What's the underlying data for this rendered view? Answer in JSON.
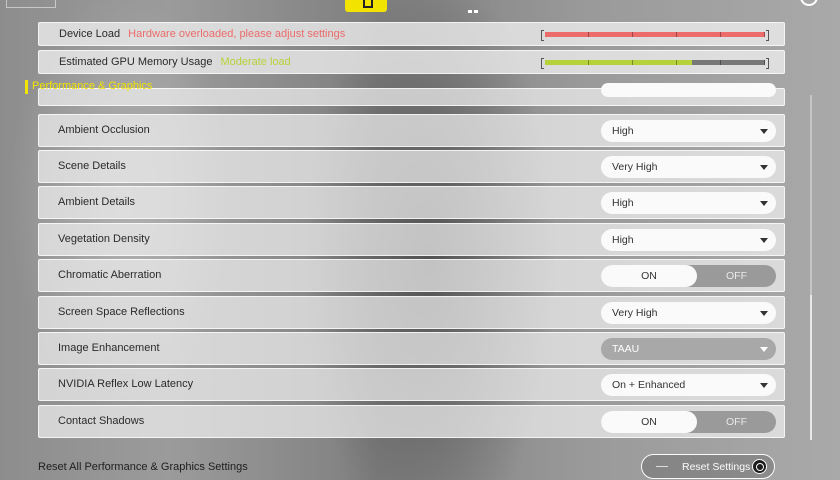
{
  "colors": {
    "accent": "#f2e300",
    "overload": "#ec6b6b",
    "moderate": "#b6d23a"
  },
  "top": {
    "icons": [
      "logo-icon",
      "active-tab-icon",
      "grid-icon",
      "user-icon"
    ]
  },
  "device_load": {
    "label": "Device Load",
    "status": "Hardware overloaded, please adjust settings",
    "level": 1.0
  },
  "gpu_memory": {
    "label": "Estimated GPU Memory Usage",
    "status": "Moderate load",
    "level": 0.67
  },
  "section": {
    "title": "Performance & Graphics"
  },
  "settings": [
    {
      "label": "Ambient Occlusion",
      "type": "dropdown",
      "value": "High"
    },
    {
      "label": "Scene Details",
      "type": "dropdown",
      "value": "Very High"
    },
    {
      "label": "Ambient Details",
      "type": "dropdown",
      "value": "High"
    },
    {
      "label": "Vegetation Density",
      "type": "dropdown",
      "value": "High"
    },
    {
      "label": "Chromatic Aberration",
      "type": "toggle",
      "on_label": "ON",
      "off_label": "OFF",
      "value": "ON"
    },
    {
      "label": "Screen Space Reflections",
      "type": "dropdown",
      "value": "Very High"
    },
    {
      "label": "Image Enhancement",
      "type": "dropdown",
      "value": "TAAU",
      "disabled": true
    },
    {
      "label": "NVIDIA Reflex Low Latency",
      "type": "dropdown",
      "value": "On + Enhanced"
    },
    {
      "label": "Contact Shadows",
      "type": "toggle",
      "on_label": "ON",
      "off_label": "OFF",
      "value": "ON"
    }
  ],
  "footer": {
    "reset_label": "Reset All Performance & Graphics Settings",
    "reset_button": "Reset Settings"
  }
}
